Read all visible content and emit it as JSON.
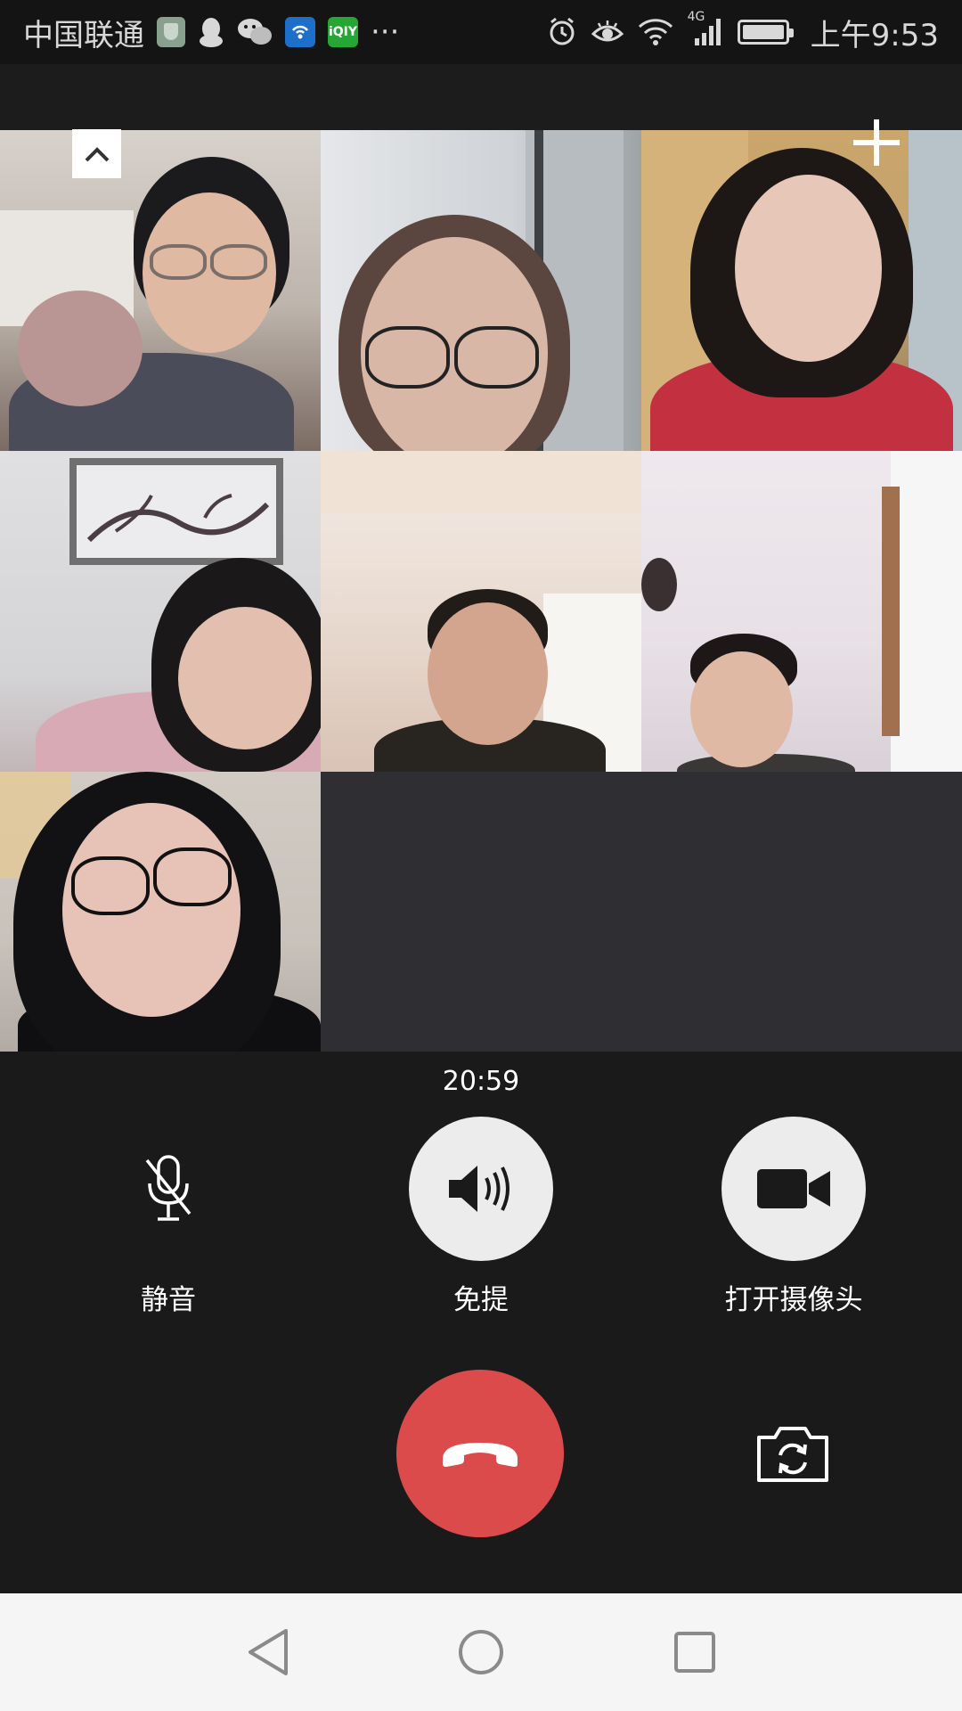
{
  "status_bar": {
    "carrier": "中国联通",
    "more": "···",
    "network": "4G",
    "time": "上午9:53",
    "left_icons": [
      "shield-icon",
      "qq-icon",
      "wechat-icon",
      "wifi-hotspot-app-icon",
      "iqiyi-icon"
    ],
    "right_icons": [
      "alarm-icon",
      "eye-care-icon",
      "wifi-icon",
      "signal-icon",
      "battery-icon"
    ],
    "iqiyi_label": "iQIY"
  },
  "grid": {
    "participants": 7,
    "empty_slots": 2
  },
  "call": {
    "duration": "20:59"
  },
  "controls": {
    "mute_label": "静音",
    "speaker_label": "免提",
    "camera_label": "打开摄像头"
  },
  "colors": {
    "background": "#1a1a1b",
    "hangup": "#dc4b4b",
    "control_circle": "#ececec",
    "empty_tile": "#2f2f33",
    "nav_bar": "#f5f5f5"
  }
}
